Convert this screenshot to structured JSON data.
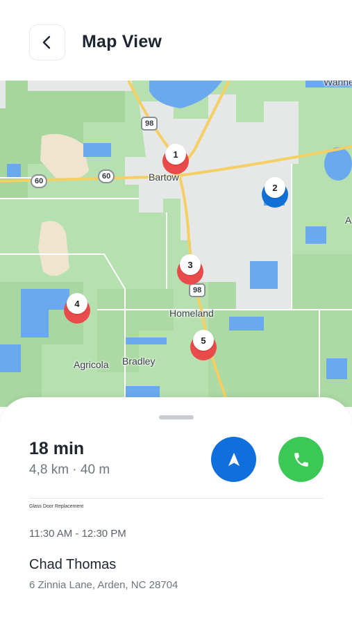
{
  "header": {
    "title": "Map View",
    "back_icon": "chevron-left-icon"
  },
  "map": {
    "places": [
      "Bartow",
      "Homeland",
      "Agricola",
      "Bradley",
      "Wahne",
      "A"
    ],
    "route_shields": [
      "98",
      "60",
      "60",
      "98"
    ],
    "markers": [
      {
        "number": "1",
        "color": "#e94b4b"
      },
      {
        "number": "2",
        "color": "#1170d6"
      },
      {
        "number": "3",
        "color": "#e94b4b"
      },
      {
        "number": "4",
        "color": "#e94b4b"
      },
      {
        "number": "5",
        "color": "#e94b4b"
      }
    ]
  },
  "sheet": {
    "eta": "18 min",
    "distance": "4,8 km · 40 m",
    "navigate_icon": "navigation-arrow-icon",
    "call_icon": "phone-icon",
    "job_type": "Glass Door Replacement",
    "time_window": "11:30 AM - 12:30 PM",
    "customer_name": "Chad Thomas",
    "address": "6 Zinnia Lane, Arden, NC 28704"
  },
  "colors": {
    "accent_blue": "#0f6fdc",
    "call_green": "#3cc856",
    "marker_red": "#e94b4b",
    "marker_blue": "#1170d6"
  }
}
